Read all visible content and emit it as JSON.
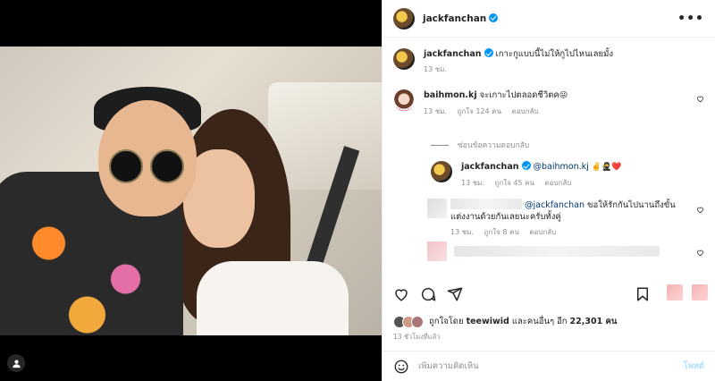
{
  "header": {
    "username": "jackfanchan",
    "more_label": "•••"
  },
  "caption": {
    "username": "jackfanchan",
    "text": "เกาะกูแบบนี้ไม่ให้กูไปไหนเลยมั้ง",
    "time": "13 ชม."
  },
  "comments": [
    {
      "username": "baihmon.kj",
      "text": "จะเกาะไปตลอดชีวิตค",
      "emoji": "😜",
      "time": "13 ชม.",
      "likes": "ถูกใจ 124 คน",
      "reply_label": "ตอบกลับ"
    }
  ],
  "hide_replies_label": "ซ่อนข้อความตอบกลับ",
  "replies": [
    {
      "username": "jackfanchan",
      "mention": "@baihmon.kj",
      "emoji": "✌️🥷❤️",
      "time": "13 ชม.",
      "likes": "ถูกใจ 45 คน",
      "reply_label": "ตอบกลับ"
    },
    {
      "mention": "@jackfanchan",
      "text": "ขอให้รักกันไปนานถึงขั้นแต่งงานด้วยกันเลยนะครับทั้งคู่",
      "time": "13 ชม.",
      "likes": "ถูกใจ 8 คน",
      "reply_label": "ตอบกลับ"
    }
  ],
  "likes_summary": {
    "prefix": "ถูกใจโดย",
    "user": "teewiwid",
    "middle": "และคนอื่นๆ อีก",
    "count": "22,301 คน"
  },
  "time_ago": "13 ชั่วโมงที่แล้ว",
  "composer": {
    "placeholder": "เพิ่มความคิดเห็น",
    "post_label": "โพสต์"
  },
  "icons": {
    "like": "heart-icon",
    "comment": "comment-icon",
    "share": "send-icon",
    "save": "bookmark-icon",
    "emoji": "smiley-icon",
    "tag": "user-tag-icon"
  }
}
